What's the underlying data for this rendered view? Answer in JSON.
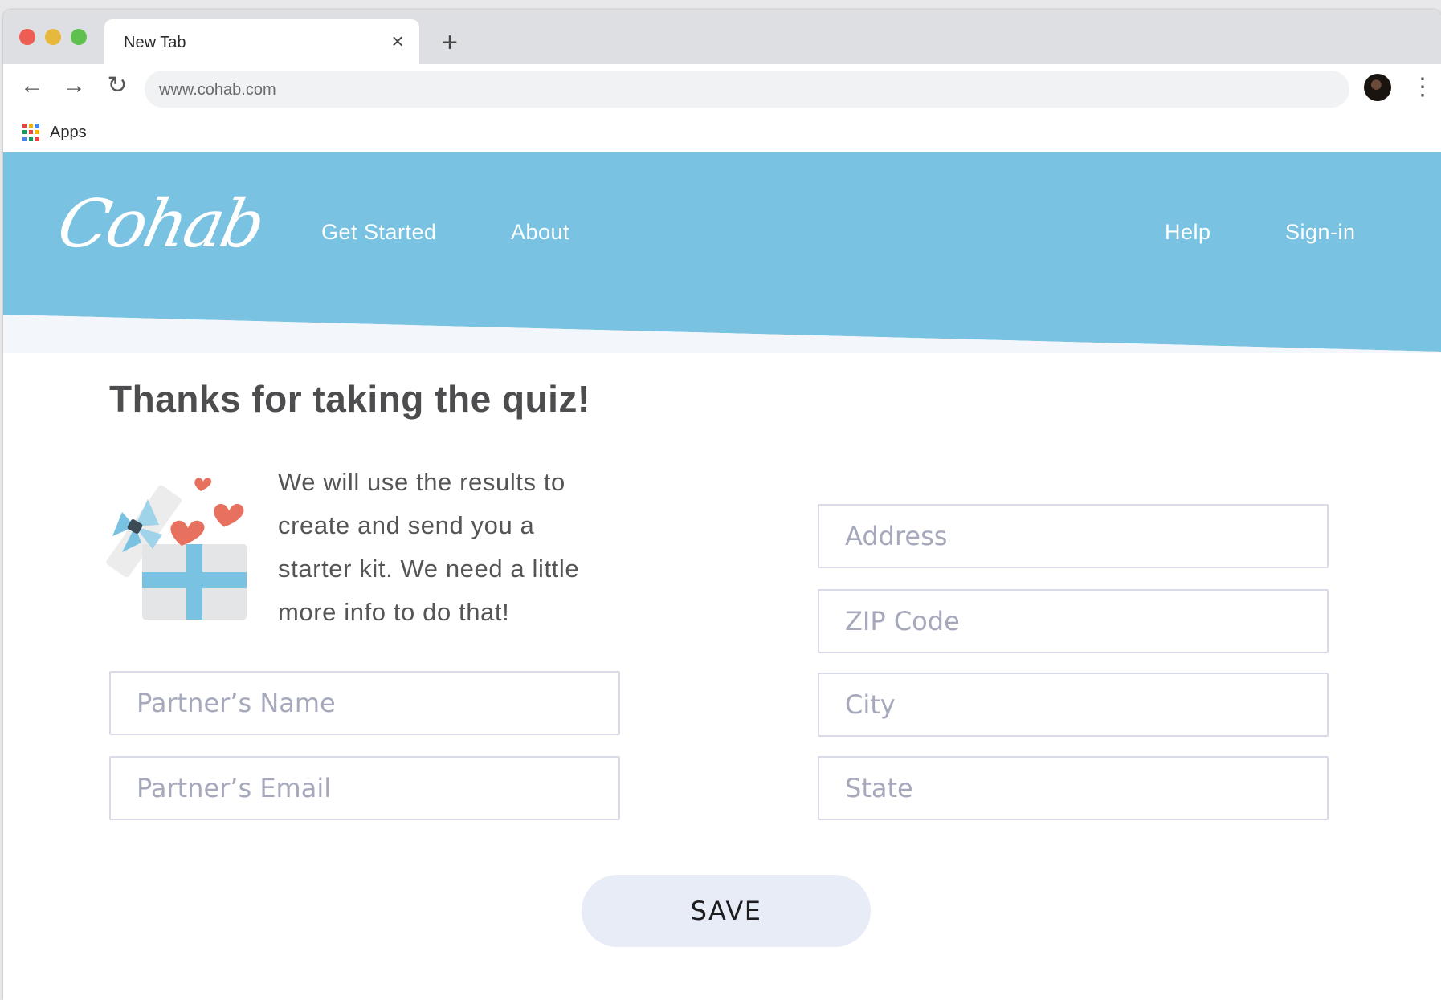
{
  "browser": {
    "tab_title": "New Tab",
    "tab_close_glyph": "×",
    "new_tab_glyph": "+",
    "back_glyph": "←",
    "forward_glyph": "→",
    "reload_glyph": "↻",
    "menu_glyph": "⋮",
    "url": "www.cohab.com",
    "bookmarks": {
      "apps_label": "Apps"
    }
  },
  "site": {
    "logo": "Cohab",
    "nav_left": [
      "Get Started",
      "About"
    ],
    "nav_right": [
      "Help",
      "Sign-in"
    ],
    "header_color": "#79c2e1"
  },
  "main": {
    "title": "Thanks for taking the quiz!",
    "intro": "We will use the results to create and send you a starter kit. We need a little more info to do that!",
    "form": {
      "partner_name_placeholder": "Partner’s Name",
      "partner_email_placeholder": "Partner’s Email",
      "address_placeholder": "Address",
      "zip_placeholder": "ZIP Code",
      "city_placeholder": "City",
      "state_placeholder": "State",
      "save_label": "SAVE"
    }
  },
  "icons": [
    "close-icon",
    "plus-icon",
    "back-arrow-icon",
    "forward-arrow-icon",
    "reload-icon",
    "profile-avatar",
    "kebab-menu-icon",
    "apps-grid-icon",
    "gift-box-icon"
  ]
}
